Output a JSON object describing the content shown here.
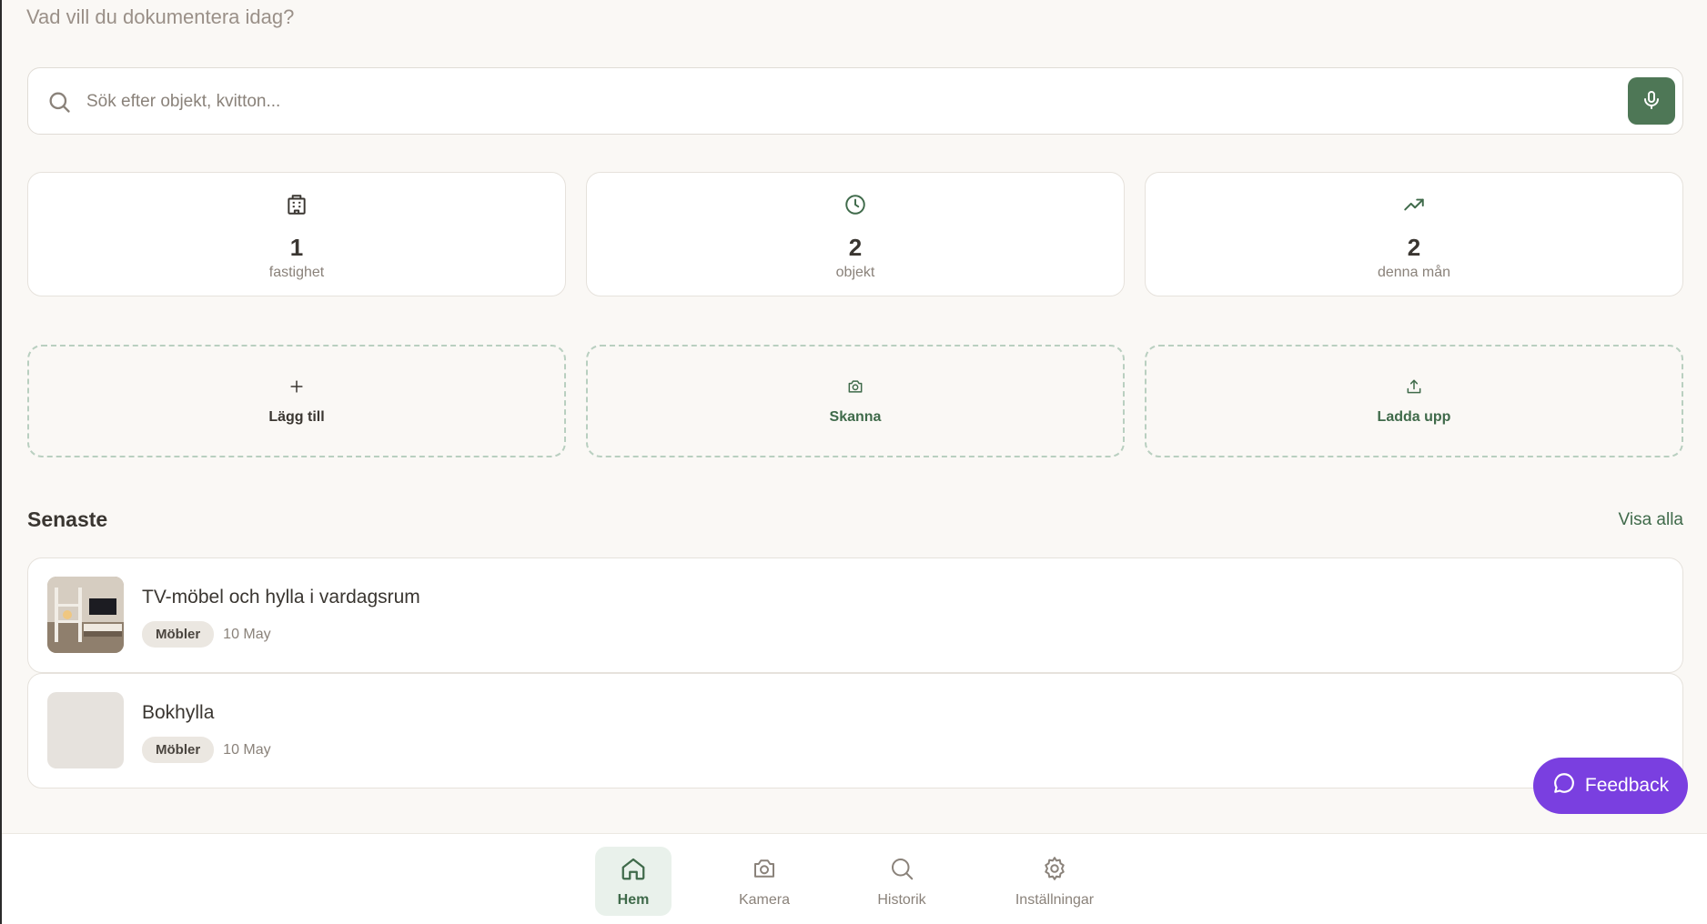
{
  "header": {
    "prompt": "Vad vill du dokumentera idag?"
  },
  "search": {
    "placeholder": "Sök efter objekt, kvitton...",
    "icon": "search-icon",
    "mic_icon": "microphone-icon"
  },
  "stats": [
    {
      "icon": "building-icon",
      "value": "1",
      "label": "fastighet"
    },
    {
      "icon": "clock-icon",
      "value": "2",
      "label": "objekt"
    },
    {
      "icon": "trending-up-icon",
      "value": "2",
      "label": "denna mån"
    }
  ],
  "actions": [
    {
      "icon": "plus-icon",
      "label": "Lägg till"
    },
    {
      "icon": "camera-icon",
      "label": "Skanna"
    },
    {
      "icon": "upload-icon",
      "label": "Ladda upp"
    }
  ],
  "recent": {
    "title": "Senaste",
    "see_all": "Visa alla",
    "items": [
      {
        "title": "TV-möbel och hylla i vardagsrum",
        "category": "Möbler",
        "date": "10 May",
        "has_image": true
      },
      {
        "title": "Bokhylla",
        "category": "Möbler",
        "date": "10 May",
        "has_image": false
      }
    ]
  },
  "feedback": {
    "label": "Feedback"
  },
  "nav": {
    "items": [
      {
        "label": "Hem",
        "icon": "home-icon",
        "active": true
      },
      {
        "label": "Kamera",
        "icon": "camera-icon",
        "active": false
      },
      {
        "label": "Historik",
        "icon": "search-icon",
        "active": false
      },
      {
        "label": "Inställningar",
        "icon": "gear-icon",
        "active": false
      }
    ]
  },
  "colors": {
    "accent": "#4e7756",
    "accent_text": "#3f6a4a",
    "feedback": "#7a3fe0",
    "background": "#faf8f5"
  }
}
